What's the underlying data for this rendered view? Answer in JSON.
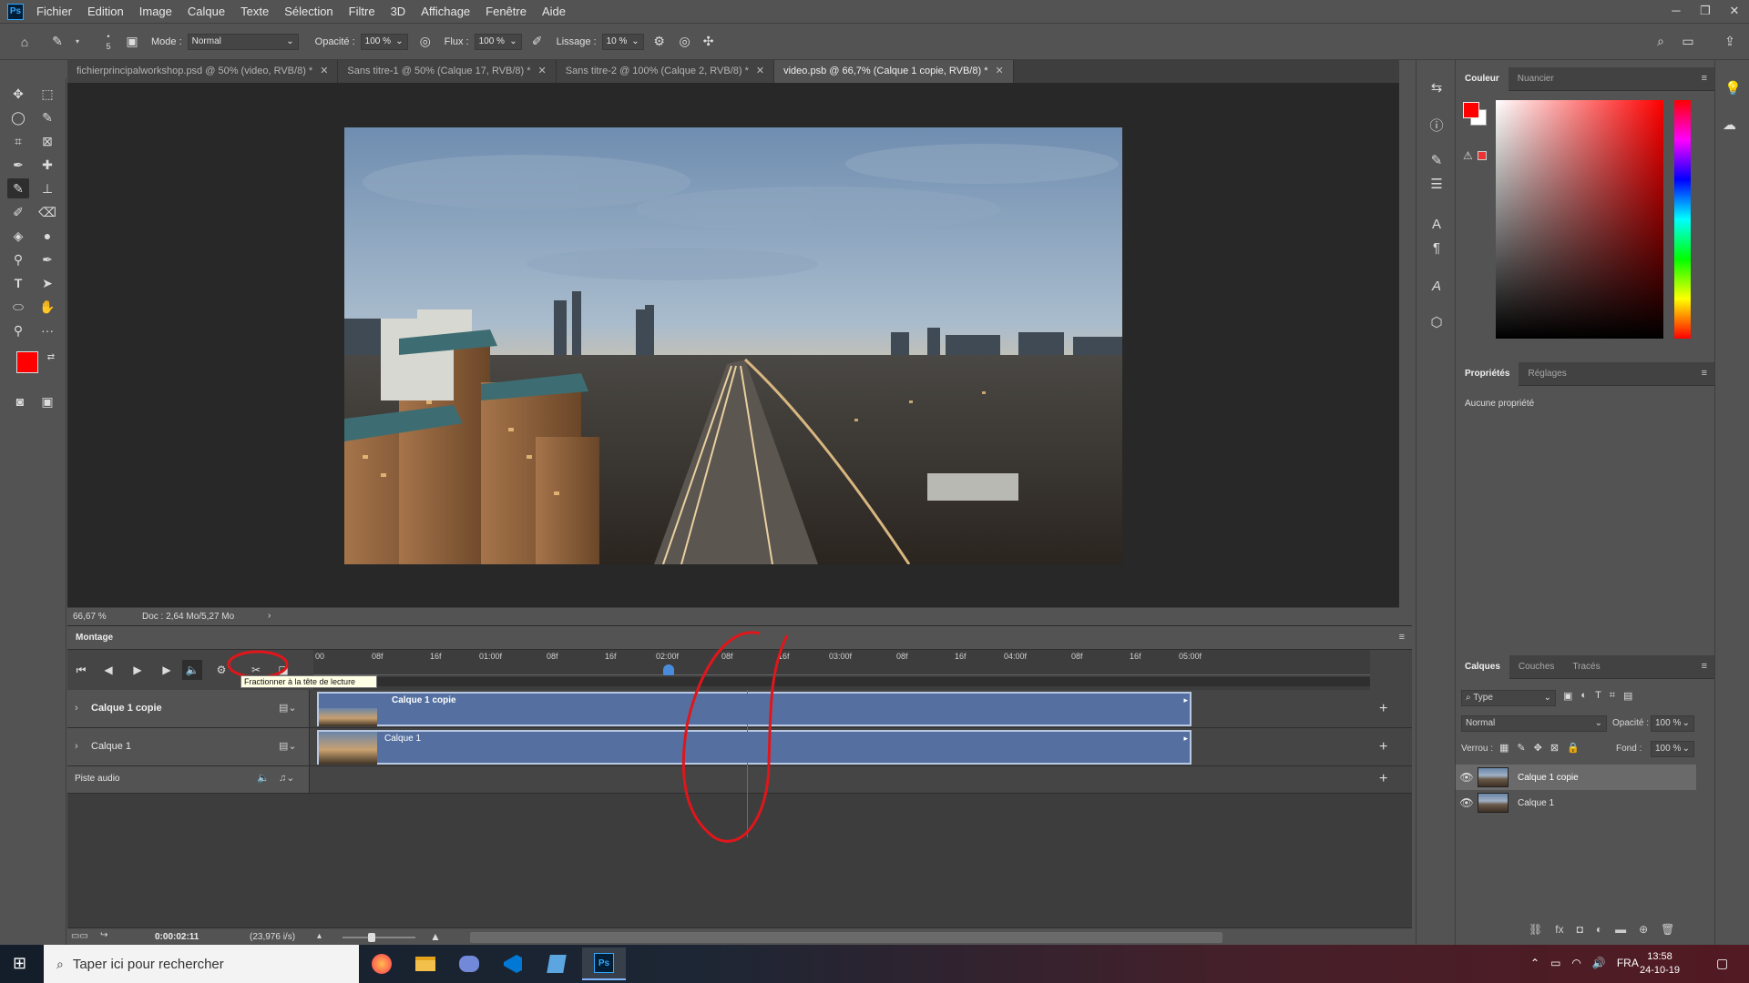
{
  "menu": {
    "app_logo": "Ps",
    "items": [
      "Fichier",
      "Edition",
      "Image",
      "Calque",
      "Texte",
      "Sélection",
      "Filtre",
      "3D",
      "Affichage",
      "Fenêtre",
      "Aide"
    ],
    "window_controls": [
      "─",
      "❐",
      "✕"
    ]
  },
  "options": {
    "brush_size": "5",
    "mode_label": "Mode :",
    "mode_value": "Normal",
    "opacity_label": "Opacité :",
    "opacity_value": "100 %",
    "flow_label": "Flux :",
    "flow_value": "100 %",
    "smoothing_label": "Lissage :",
    "smoothing_value": "10 %"
  },
  "tabs": [
    {
      "label": "fichierprincipalworkshop.psd @ 50% (video, RVB/8) *"
    },
    {
      "label": "Sans titre-1 @ 50% (Calque 17, RVB/8) *"
    },
    {
      "label": "Sans titre-2 @ 100% (Calque 2, RVB/8) *"
    },
    {
      "label": "video.psb @ 66,7% (Calque 1 copie, RVB/8) *"
    }
  ],
  "status": {
    "zoom": "66,67 %",
    "doc": "Doc : 2,64 Mo/5,27 Mo",
    "arrow": "›"
  },
  "timeline": {
    "title": "Montage",
    "ruler": [
      "00",
      "08f",
      "16f",
      "01:00f",
      "08f",
      "16f",
      "02:00f",
      "08f",
      "16f",
      "03:00f",
      "08f",
      "16f",
      "04:00f",
      "08f",
      "16f",
      "05:00f"
    ],
    "tooltip": "Fractionner à la tête de lecture",
    "tracks": [
      {
        "name": "Calque 1 copie",
        "clip": "Calque 1 copie"
      },
      {
        "name": "Calque 1",
        "clip": "Calque 1"
      }
    ],
    "audio_track": "Piste audio",
    "timecode": "0:00:02:11",
    "fps": "(23,976 i/s)"
  },
  "color_panel": {
    "tabs": [
      "Couleur",
      "Nuancier"
    ],
    "foreground": "#ff0000",
    "background": "#ffffff"
  },
  "properties_panel": {
    "tabs": [
      "Propriétés",
      "Réglages"
    ],
    "empty_text": "Aucune propriété"
  },
  "layers_panel": {
    "tabs": [
      "Calques",
      "Couches",
      "Tracés"
    ],
    "filter_label": "Type",
    "blend_mode": "Normal",
    "opacity_label": "Opacité :",
    "opacity_value": "100 %",
    "lock_label": "Verrou :",
    "fill_label": "Fond :",
    "fill_value": "100 %",
    "layers": [
      {
        "name": "Calque 1 copie",
        "selected": true
      },
      {
        "name": "Calque 1",
        "selected": false
      }
    ]
  },
  "taskbar": {
    "search_placeholder": "Taper ici pour rechercher",
    "language": "FRA",
    "time": "13:58",
    "date": "24-10-19"
  },
  "accent": {
    "annotation_red": "#e0161b",
    "clip_blue": "#5570a0",
    "playhead_red": "#e53935"
  }
}
